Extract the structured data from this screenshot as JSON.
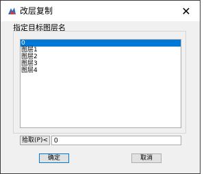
{
  "window": {
    "title": "改层复制",
    "close_symbol": "✕"
  },
  "group": {
    "label": "指定目标图层名"
  },
  "layer_list": {
    "items": [
      "0",
      "图层1",
      "图层2",
      "图层3",
      "图层4"
    ],
    "selected_index": 0
  },
  "pick": {
    "button_label": "拾取(P)<",
    "input_value": "0"
  },
  "buttons": {
    "ok": "确定",
    "cancel": "取消"
  },
  "colors": {
    "selection": "#0078d7",
    "dialog_background": "#f0f0f0"
  },
  "icons": {
    "app": "gstarcad-app-icon",
    "close": "close-icon"
  }
}
